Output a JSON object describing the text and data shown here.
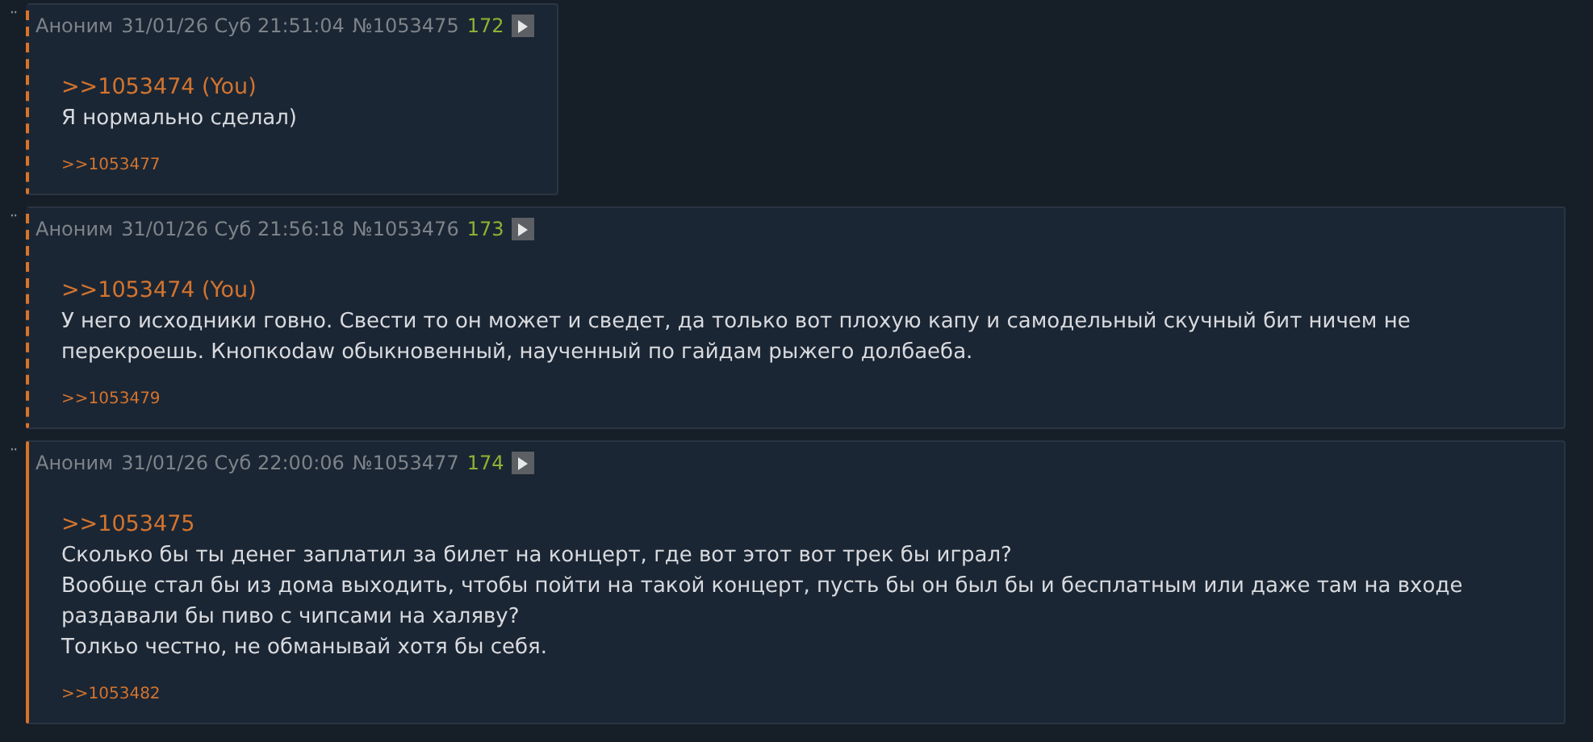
{
  "posts": [
    {
      "marker": "··",
      "author": "Аноним",
      "date": "31/01/26 Суб 21:51:04",
      "number": "№1053475",
      "index": "172",
      "highlighted": false,
      "quote": ">>1053474 (You)",
      "body": [
        "Я нормально сделал)"
      ],
      "replies": [
        ">>1053477"
      ]
    },
    {
      "marker": "··",
      "author": "Аноним",
      "date": "31/01/26 Суб 21:56:18",
      "number": "№1053476",
      "index": "173",
      "highlighted": false,
      "quote": ">>1053474 (You)",
      "body": [
        "У него исходники говно. Свести то он может и сведет, да только вот плохую капу и самодельный скучный бит ничем не перекроешь. Кнопкоdaw обыкновенный, наученный по гайдам рыжего долбаеба."
      ],
      "replies": [
        ">>1053479"
      ]
    },
    {
      "marker": "··",
      "author": "Аноним",
      "date": "31/01/26 Суб 22:00:06",
      "number": "№1053477",
      "index": "174",
      "highlighted": true,
      "quote": ">>1053475",
      "body": [
        "Сколько бы ты денег заплатил за билет на концерт, где вот этот вот трек бы играл?",
        "Вообще стал бы из дома выходить, чтобы пойти на такой концерт, пусть бы он был бы и бесплатным или даже там на входе раздавали бы пиво с чипсами на халяву?",
        "Толкьо честно, не обманывай хотя бы себя."
      ],
      "replies": [
        ">>1053482"
      ]
    }
  ]
}
